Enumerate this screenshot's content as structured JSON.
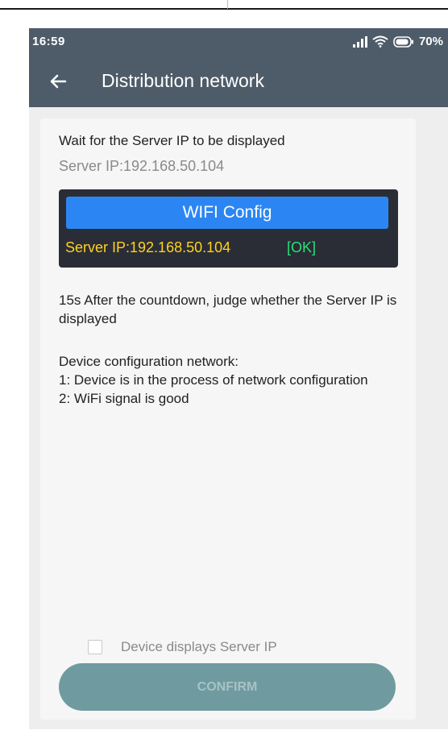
{
  "status_bar": {
    "time": "16:59",
    "battery": "70%",
    "icons": [
      "signal-icon",
      "wifi-icon",
      "battery-icon"
    ]
  },
  "app_bar": {
    "title": "Distribution network",
    "back_icon": "arrow-left-icon"
  },
  "content": {
    "heading": "Wait for the Server IP to be displayed",
    "server_ip": "Server IP:192.168.50.104",
    "device_preview": {
      "button_label": "WIFI Config",
      "ip_text": "Server IP:192.168.50.104",
      "status_text": "[OK]"
    },
    "instruction": "15s After the countdown, judge whether the Server IP is displayed",
    "config_title": "Device configuration network:",
    "config_items": [
      "1: Device is in the process of network configuration",
      "2: WiFi signal is good"
    ],
    "checkbox_label": "Device displays Server IP",
    "checkbox_checked": false,
    "confirm_label": "CONFIRM"
  },
  "colors": {
    "header": "#4e5c69",
    "wifi_button": "#2b86f4",
    "preview_ip": "#ffd21f",
    "preview_ok": "#28e07a",
    "confirm_button": "#6f9ba0"
  }
}
